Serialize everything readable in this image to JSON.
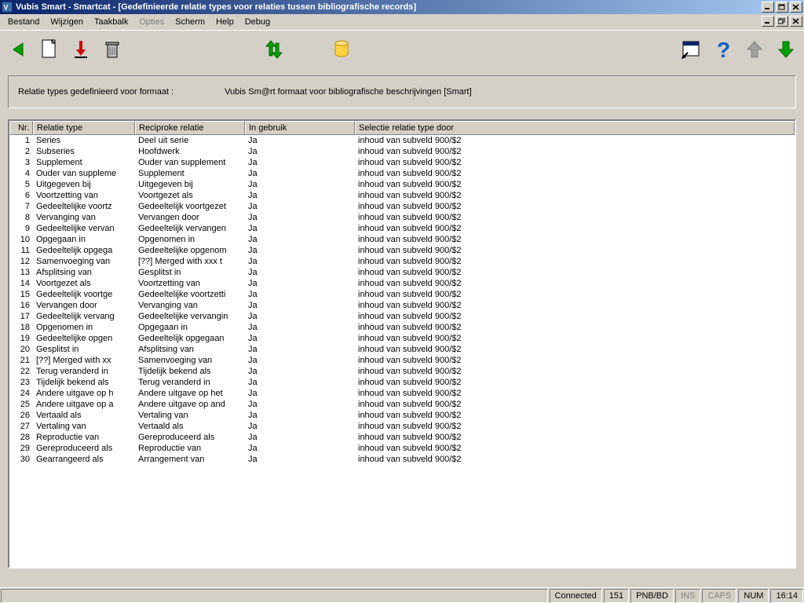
{
  "window": {
    "title": "Vubis Smart - Smartcat - [Gedefinieerde relatie types voor relaties tussen bibliografische records]"
  },
  "menu": {
    "items": [
      "Bestand",
      "Wijzigen",
      "Taakbalk",
      "Opties",
      "Scherm",
      "Help",
      "Debug"
    ],
    "disabled_index": 3
  },
  "info": {
    "label": "Relatie types gedefinieerd voor formaat :",
    "value": "Vubis Sm@rt formaat voor bibliografische beschrijvingen [Smart]"
  },
  "columns": {
    "nr": "Nr.",
    "type": "Relatie type",
    "recip": "Reciproke relatie",
    "use": "In gebruik",
    "sel": "Selectie relatie type door"
  },
  "rows": [
    {
      "nr": "1",
      "type": "Series",
      "recip": "Deel uit serie",
      "use": "Ja",
      "sel": "inhoud van subveld 900/$2"
    },
    {
      "nr": "2",
      "type": "Subseries",
      "recip": "Hoofdwerk",
      "use": "Ja",
      "sel": "inhoud van subveld 900/$2"
    },
    {
      "nr": "3",
      "type": "Supplement",
      "recip": "Ouder van supplement",
      "use": "Ja",
      "sel": "inhoud van subveld 900/$2"
    },
    {
      "nr": "4",
      "type": "Ouder van suppleme",
      "recip": "Supplement",
      "use": "Ja",
      "sel": "inhoud van subveld 900/$2"
    },
    {
      "nr": "5",
      "type": "Uitgegeven bij",
      "recip": "Uitgegeven bij",
      "use": "Ja",
      "sel": "inhoud van subveld 900/$2"
    },
    {
      "nr": "6",
      "type": "Voortzetting van",
      "recip": "Voortgezet als",
      "use": "Ja",
      "sel": "inhoud van subveld 900/$2"
    },
    {
      "nr": "7",
      "type": "Gedeeltelijke voortz",
      "recip": "Gedeeltelijk voortgezet",
      "use": "Ja",
      "sel": "inhoud van subveld 900/$2"
    },
    {
      "nr": "8",
      "type": "Vervanging van",
      "recip": "Vervangen door",
      "use": "Ja",
      "sel": "inhoud van subveld 900/$2"
    },
    {
      "nr": "9",
      "type": "Gedeeltelijke vervan",
      "recip": "Gedeeltelijk vervangen",
      "use": "Ja",
      "sel": "inhoud van subveld 900/$2"
    },
    {
      "nr": "10",
      "type": "Opgegaan in",
      "recip": "Opgenomen in",
      "use": "Ja",
      "sel": "inhoud van subveld 900/$2"
    },
    {
      "nr": "11",
      "type": "Gedeeltelijk opgega",
      "recip": "Gedeeltelijke opgenom",
      "use": "Ja",
      "sel": "inhoud van subveld 900/$2"
    },
    {
      "nr": "12",
      "type": "Samenvoeging van",
      "recip": "[??] Merged with xxx t",
      "use": "Ja",
      "sel": "inhoud van subveld 900/$2"
    },
    {
      "nr": "13",
      "type": "Afsplitsing van",
      "recip": "Gesplitst in",
      "use": "Ja",
      "sel": "inhoud van subveld 900/$2"
    },
    {
      "nr": "14",
      "type": "Voortgezet als",
      "recip": "Voortzetting van",
      "use": "Ja",
      "sel": "inhoud van subveld 900/$2"
    },
    {
      "nr": "15",
      "type": "Gedeeltelijk voortge",
      "recip": "Gedeeltelijke voortzetti",
      "use": "Ja",
      "sel": "inhoud van subveld 900/$2"
    },
    {
      "nr": "16",
      "type": "Vervangen door",
      "recip": "Vervanging van",
      "use": "Ja",
      "sel": "inhoud van subveld 900/$2"
    },
    {
      "nr": "17",
      "type": "Gedeeltelijk vervang",
      "recip": "Gedeeltelijke vervangin",
      "use": "Ja",
      "sel": "inhoud van subveld 900/$2"
    },
    {
      "nr": "18",
      "type": "Opgenomen in",
      "recip": "Opgegaan in",
      "use": "Ja",
      "sel": "inhoud van subveld 900/$2"
    },
    {
      "nr": "19",
      "type": "Gedeeltelijke opgen",
      "recip": "Gedeeltelijk opgegaan",
      "use": "Ja",
      "sel": "inhoud van subveld 900/$2"
    },
    {
      "nr": "20",
      "type": "Gesplitst in",
      "recip": "Afsplitsing van",
      "use": "Ja",
      "sel": "inhoud van subveld 900/$2"
    },
    {
      "nr": "21",
      "type": "[??] Merged with xx",
      "recip": "Samenvoeging van",
      "use": "Ja",
      "sel": "inhoud van subveld 900/$2"
    },
    {
      "nr": "22",
      "type": "Terug veranderd in",
      "recip": "Tijdelijk bekend als",
      "use": "Ja",
      "sel": "inhoud van subveld 900/$2"
    },
    {
      "nr": "23",
      "type": "Tijdelijk bekend als",
      "recip": "Terug veranderd in",
      "use": "Ja",
      "sel": "inhoud van subveld 900/$2"
    },
    {
      "nr": "24",
      "type": "Andere uitgave op h",
      "recip": "Andere uitgave op het",
      "use": "Ja",
      "sel": "inhoud van subveld 900/$2"
    },
    {
      "nr": "25",
      "type": "Andere uitgave op a",
      "recip": "Andere uitgave op and",
      "use": "Ja",
      "sel": "inhoud van subveld 900/$2"
    },
    {
      "nr": "26",
      "type": "Vertaald als",
      "recip": "Vertaling van",
      "use": "Ja",
      "sel": "inhoud van subveld 900/$2"
    },
    {
      "nr": "27",
      "type": "Vertaling van",
      "recip": "Vertaald als",
      "use": "Ja",
      "sel": "inhoud van subveld 900/$2"
    },
    {
      "nr": "28",
      "type": "Reproductie van",
      "recip": "Gereproduceerd als",
      "use": "Ja",
      "sel": "inhoud van subveld 900/$2"
    },
    {
      "nr": "29",
      "type": "Gereproduceerd als",
      "recip": "Reproductie van",
      "use": "Ja",
      "sel": "inhoud van subveld 900/$2"
    },
    {
      "nr": "30",
      "type": "Gearrangeerd als",
      "recip": "Arrangement van",
      "use": "Ja",
      "sel": "inhoud van subveld 900/$2"
    }
  ],
  "status": {
    "connected": "Connected",
    "num1": "151",
    "db": "PNB/BD",
    "ins": "INS",
    "caps": "CAPS",
    "num": "NUM",
    "time": "16:14"
  }
}
